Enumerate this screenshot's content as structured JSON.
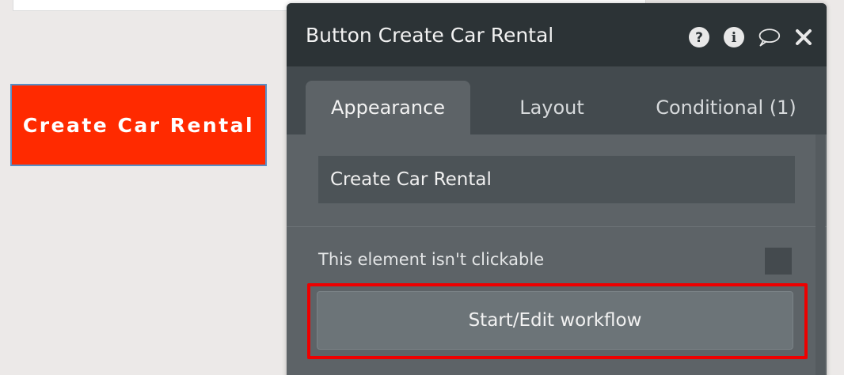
{
  "canvas": {
    "button_label": "Create Car Rental",
    "button_color": "#ff2a00"
  },
  "panel": {
    "title": "Button Create Car Rental",
    "header_icons": [
      "help-icon",
      "info-icon",
      "comment-icon",
      "close-icon"
    ],
    "tabs": [
      {
        "label": "Appearance",
        "active": true
      },
      {
        "label": "Layout",
        "active": false
      },
      {
        "label": "Conditional (1)",
        "active": false
      }
    ],
    "text_field_value": "Create Car Rental",
    "clickable_label": "This element isn't clickable",
    "clickable_checked": false,
    "workflow_button_label": "Start/Edit workflow",
    "highlight_color": "#ee0000"
  }
}
